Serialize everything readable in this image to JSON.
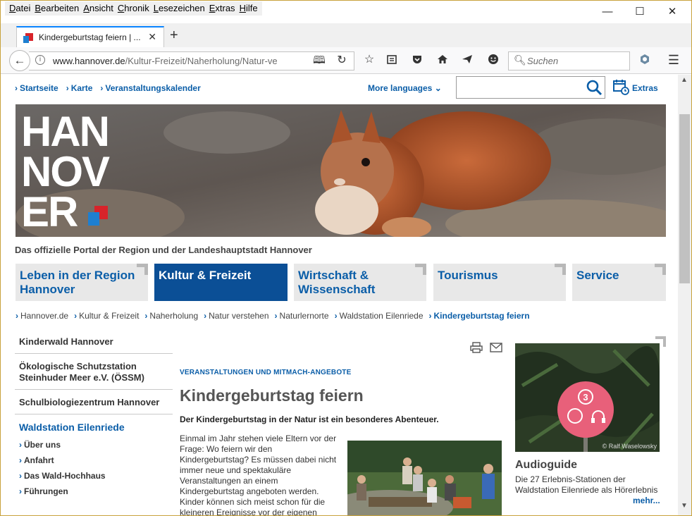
{
  "menubar": {
    "items": [
      "Datei",
      "Bearbeiten",
      "Ansicht",
      "Chronik",
      "Lesezeichen",
      "Extras",
      "Hilfe"
    ]
  },
  "window_controls": {
    "minimize": "—",
    "maximize": "☐",
    "close": "✕"
  },
  "tab": {
    "title": "Kindergeburtstag feiern | ...",
    "close": "✕",
    "new_tab": "+"
  },
  "navbar": {
    "back": "←",
    "url_domain": "www.hannover.de",
    "url_path": "/Kultur-Freizeit/Naherholung/Natur-ve",
    "search_placeholder": "Suchen"
  },
  "site_header": {
    "top_links": [
      "Startseite",
      "Karte",
      "Veranstaltungskalender"
    ],
    "more_languages": "More languages",
    "search_value": "",
    "extras": "Extras"
  },
  "hero": {
    "logo_lines": [
      "HAN",
      "NOV",
      "ER"
    ]
  },
  "tagline": "Das offizielle Portal der Region und der Landeshauptstadt Hannover",
  "main_nav": [
    {
      "label": "Leben in der Region Hannover"
    },
    {
      "label": "Kultur & Freizeit"
    },
    {
      "label": "Wirtschaft & Wissenschaft"
    },
    {
      "label": "Tourismus"
    },
    {
      "label": "Service"
    }
  ],
  "breadcrumb": [
    "Hannover.de",
    "Kultur & Freizeit",
    "Naherholung",
    "Natur verstehen",
    "Naturlernorte",
    "Waldstation Eilenriede",
    "Kindergeburtstag feiern"
  ],
  "sidebar": {
    "items": [
      "Kinderwald Hannover",
      "Ökologische Schutzstation Steinhuder Meer e.V. (ÖSSM)",
      "Schulbiologiezentrum Hannover"
    ],
    "section_head": "Waldstation Eilenriede",
    "subitems": [
      "Über uns",
      "Anfahrt",
      "Das Wald-Hochhaus",
      "Führungen"
    ]
  },
  "article": {
    "overline": "VERANSTALTUNGEN UND MITMACH-ANGEBOTE",
    "title": "Kindergeburtstag feiern",
    "lead": "Der Kindergeburtstag in der Natur ist ein besonderes Abenteuer.",
    "body": "Einmal im Jahr stehen viele Eltern vor der Frage: Wo feiern wir den Kindergeburtstag? Es müssen dabei nicht immer neue und spektakuläre Veranstaltungen an einem Kindergeburtstag angeboten werden. Kinder können sich meist schon für die kleineren Ereignisse vor der eigenen"
  },
  "teaser": {
    "badge_number": "3",
    "credit": "© Ralf Waselowsky",
    "title": "Audioguide",
    "text": "Die 27 Erlebnis-Stationen der Waldstation Eilenriede als Hörerlebnis",
    "more": "mehr..."
  },
  "colors": {
    "brand_blue": "#0b5ea8",
    "active_nav": "#0b4f96",
    "tab_accent": "#0a84ff",
    "logo_red": "#d8232a",
    "logo_blue": "#1e7fd0"
  }
}
